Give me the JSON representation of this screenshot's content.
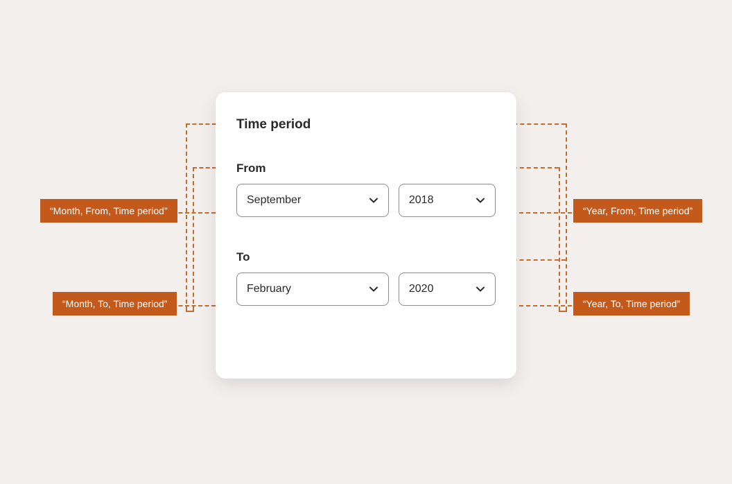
{
  "card": {
    "title": "Time period",
    "from_label": "From",
    "to_label": "To",
    "from_month": "September",
    "from_year": "2018",
    "to_month": "February",
    "to_year": "2020"
  },
  "annotations": {
    "top_left": "“Month, From, Time period”",
    "top_right": "“Year, From, Time period”",
    "bottom_left": "“Month, To, Time period”",
    "bottom_right": "“Year, To, Time period”"
  }
}
